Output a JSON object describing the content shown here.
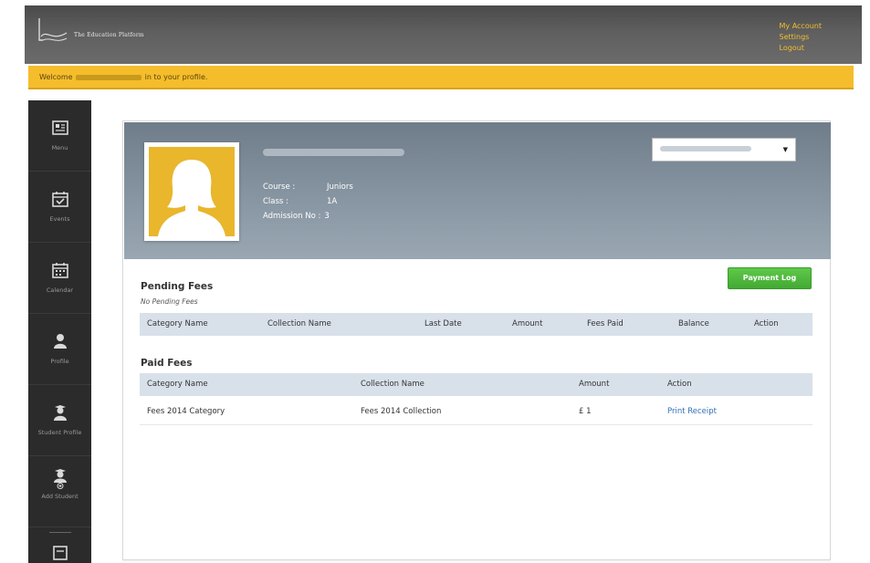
{
  "header": {
    "logo_text": "The Education Platform",
    "account_menu": [
      "My Account",
      "Settings",
      "Logout"
    ]
  },
  "welcome": {
    "prefix": "Welcome ",
    "suffix": " in to your profile."
  },
  "sidebar": {
    "items": [
      {
        "label": "Menu",
        "icon": "newspaper-icon"
      },
      {
        "label": "Events",
        "icon": "calendar-check-icon"
      },
      {
        "label": "Calendar",
        "icon": "calendar-icon"
      },
      {
        "label": "Profile",
        "icon": "user-icon"
      },
      {
        "label": "Student Profile",
        "icon": "student-icon"
      },
      {
        "label": "Add Student",
        "icon": "add-student-icon"
      }
    ]
  },
  "profile": {
    "course_label": "Course :",
    "course_value": "Juniors",
    "class_label": "Class :",
    "class_value": "1A",
    "admission_label": "Admission No :",
    "admission_value": "3"
  },
  "payment_log_label": "Payment Log",
  "pending": {
    "title": "Pending Fees",
    "empty_text": "No Pending Fees",
    "columns": [
      "Category Name",
      "Collection Name",
      "Last Date",
      "Amount",
      "Fees Paid",
      "Balance",
      "Action"
    ]
  },
  "paid": {
    "title": "Paid Fees",
    "columns": [
      "Category Name",
      "Collection Name",
      "Amount",
      "Action"
    ],
    "rows": [
      {
        "category": "Fees 2014 Category",
        "collection": "Fees 2014 Collection",
        "amount": "£ 1",
        "action": "Print Receipt"
      }
    ]
  },
  "colors": {
    "header_bg": "#5f5f5f",
    "accent_yellow": "#f5bd2b",
    "sidebar_bg": "#2b2b2b",
    "button_green": "#4fb83d",
    "table_head": "#d8e1ea",
    "link": "#2f6fb3"
  }
}
